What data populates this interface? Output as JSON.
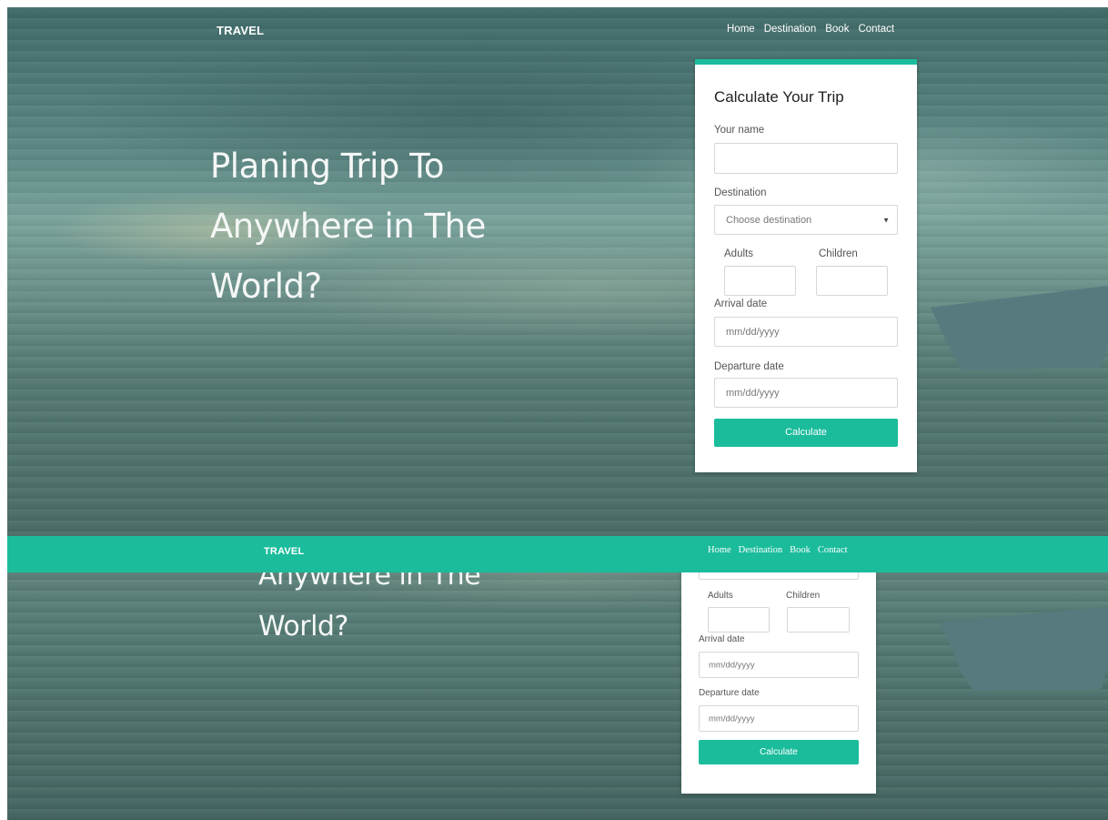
{
  "nav": {
    "brand": "TRAVEL",
    "links": [
      "Home",
      "Destination",
      "Book",
      "Contact"
    ]
  },
  "hero": {
    "headline_lines": [
      "Planing Trip To",
      "Anywhere in The",
      "World?"
    ],
    "partial_line": "Anywhere in The"
  },
  "form": {
    "title": "Calculate Your Trip",
    "name_label": "Your name",
    "destination_label": "Destination",
    "destination_placeholder": "Choose destination",
    "adults_label": "Adults",
    "children_label": "Children",
    "arrival_label": "Arrival date",
    "arrival_placeholder": "mm/dd/yyyy",
    "departure_label": "Departure date",
    "departure_placeholder": "mm/dd/yyyy",
    "submit_label": "Calculate"
  },
  "colors": {
    "accent": "#1bbc9c",
    "headline": "#f4f7f6"
  }
}
